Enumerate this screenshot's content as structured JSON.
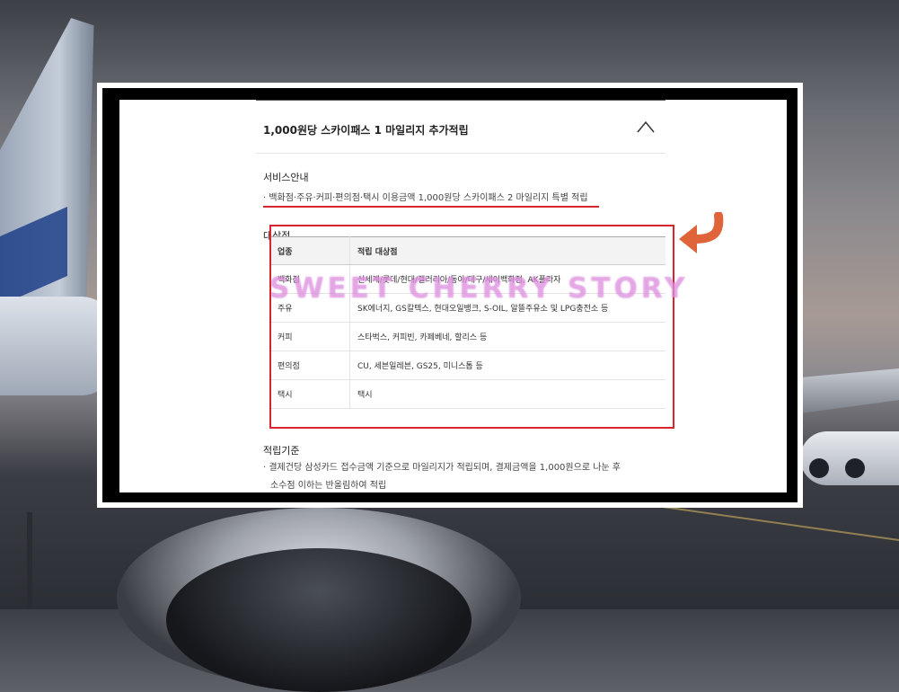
{
  "colors": {
    "accent_red": "#d9232e",
    "arrow_orange": "#e0643a"
  },
  "header": {
    "title": "1,000원당 스카이패스 1 마일리지 추가적립",
    "toggle_icon": "chevron-up-icon"
  },
  "service": {
    "title": "서비스안내",
    "bullet": "· 백화점·주유·커피·편의점·택시 이용금액 1,000원당 스카이패스 2 마일리지 특별 적립"
  },
  "targets": {
    "title": "대상점",
    "columns": [
      "업종",
      "적립 대상점"
    ],
    "rows": [
      {
        "category": "백화점",
        "stores": "신세계/롯데/현대/갤러리아/동아/대구/세이백화점, AK플라자"
      },
      {
        "category": "주유",
        "stores": "SK에너지, GS칼텍스, 현대오일뱅크, S-OIL, 알뜰주유소 및 LPG충전소 등"
      },
      {
        "category": "커피",
        "stores": "스타벅스, 커피빈, 카페베네, 할리스 등"
      },
      {
        "category": "편의점",
        "stores": "CU, 세븐일레븐, GS25, 미니스톱 등"
      },
      {
        "category": "택시",
        "stores": "택시"
      }
    ]
  },
  "criteria": {
    "title": "적립기준",
    "bullet_line1": "· 결제건당 삼성카드 접수금액 기준으로 마일리지가 적립되며, 결제금액을 1,000원으로 나눈 후",
    "bullet_line2": "소수점 이하는 반올림하여 적립"
  },
  "watermark": "SWEET CHERRY STORY"
}
